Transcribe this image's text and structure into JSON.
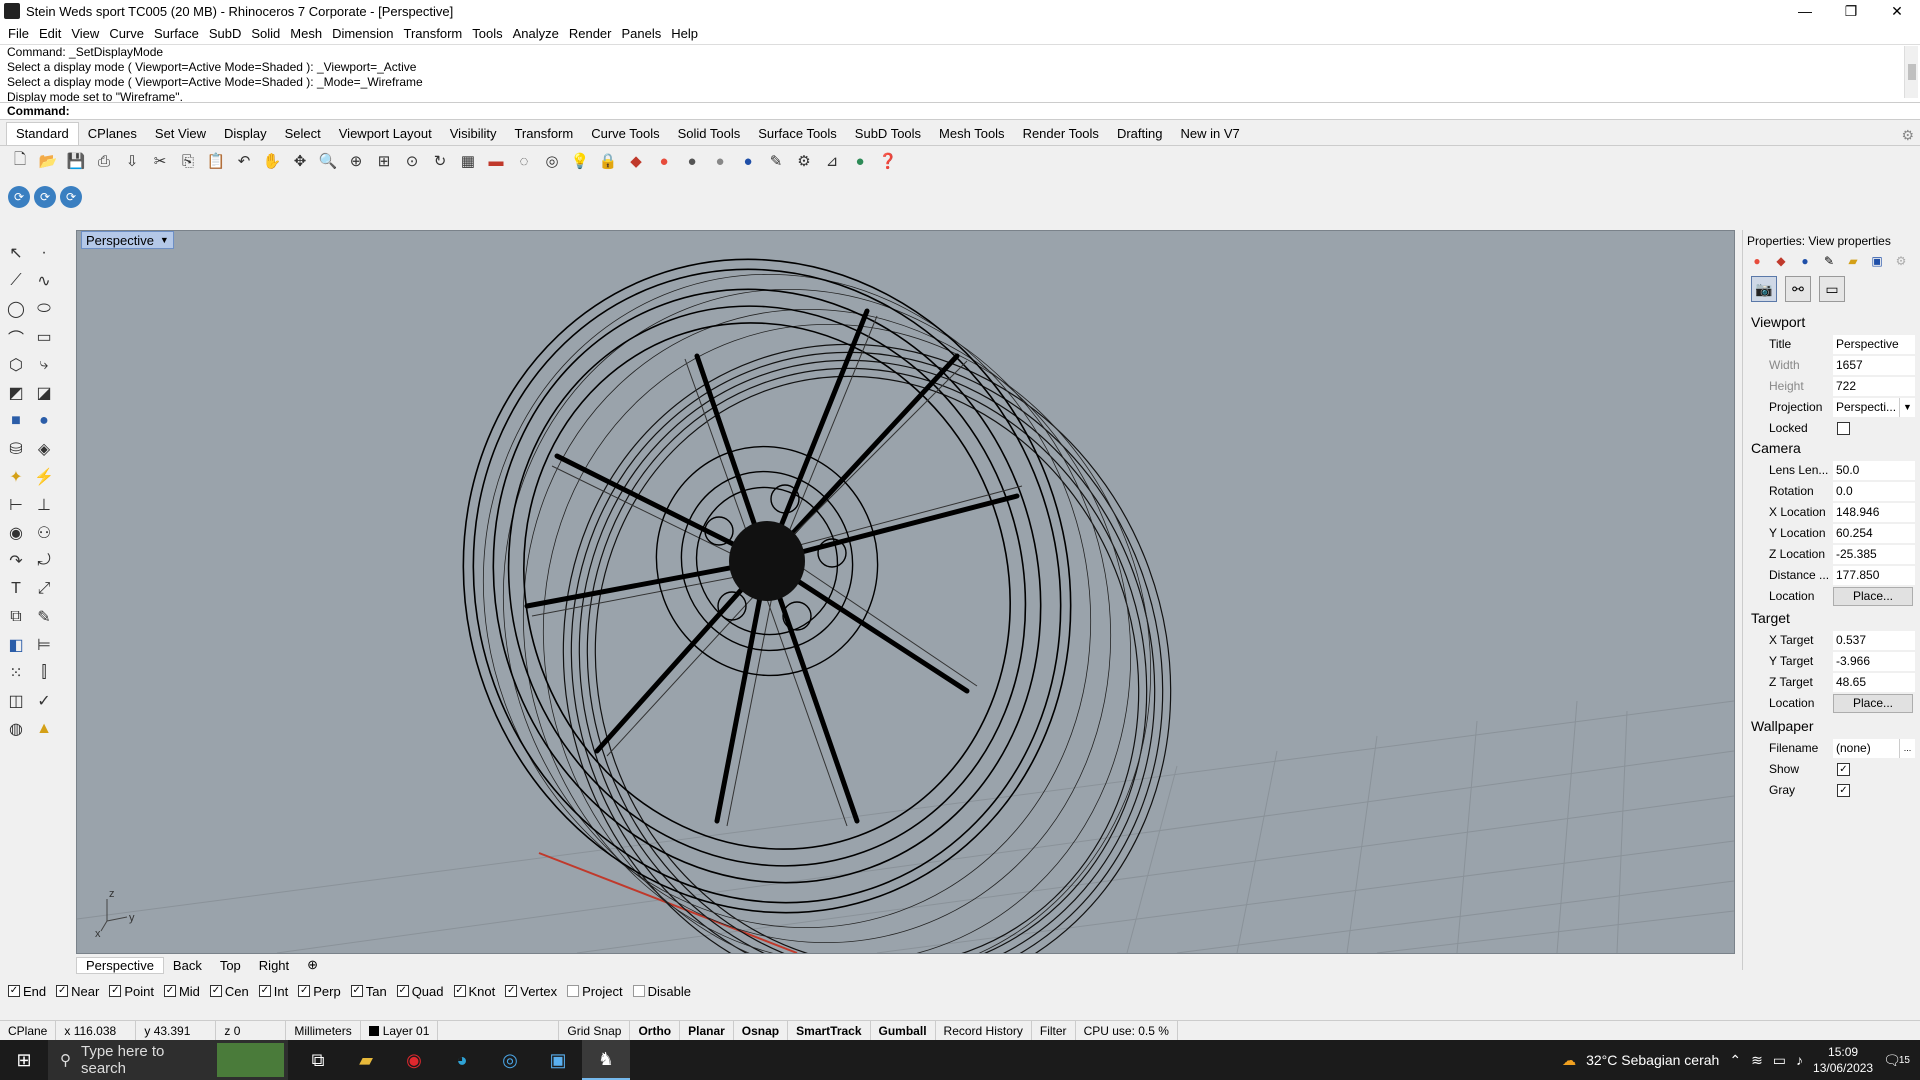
{
  "window": {
    "title": "Stein Weds sport TC005 (20 MB) - Rhinoceros 7 Corporate - [Perspective]",
    "icon": "rhino-app-icon",
    "controls": [
      "—",
      "❐",
      "✕"
    ]
  },
  "menu": [
    "File",
    "Edit",
    "View",
    "Curve",
    "Surface",
    "SubD",
    "Solid",
    "Mesh",
    "Dimension",
    "Transform",
    "Tools",
    "Analyze",
    "Render",
    "Panels",
    "Help"
  ],
  "command_history": [
    "Command: _SetDisplayMode",
    "Select a display mode ( Viewport=Active  Mode=Shaded ): _Viewport=_Active",
    "Select a display mode ( Viewport=Active  Mode=Shaded ): _Mode=_Wireframe",
    "Display mode set to \"Wireframe\"."
  ],
  "command_prompt": {
    "label": "Command:",
    "value": ""
  },
  "toolbar_tabs": [
    "Standard",
    "CPlanes",
    "Set View",
    "Display",
    "Select",
    "Viewport Layout",
    "Visibility",
    "Transform",
    "Curve Tools",
    "Solid Tools",
    "Surface Tools",
    "SubD Tools",
    "Mesh Tools",
    "Render Tools",
    "Drafting",
    "New in V7"
  ],
  "active_tab": "Standard",
  "standard_icons": [
    "new-icon",
    "open-icon",
    "save-icon",
    "print-icon",
    "import-icon",
    "cut-icon",
    "copy-icon",
    "paste-icon",
    "undo-icon",
    "pan-icon",
    "move-view-icon",
    "zoom-icon",
    "zoom-window-icon",
    "zoom-extents-icon",
    "zoom-selected-icon",
    "rotate-view-icon",
    "grid-icon",
    "car-icon",
    "object-snap-icon",
    "sphere-icon",
    "light-icon",
    "lock-icon",
    "layer-icon",
    "color-wheel-icon",
    "material-icon",
    "render-sphere-icon",
    "blue-sphere-icon",
    "tools-icon",
    "gear-icon",
    "dimension-icon",
    "world-icon",
    "help-icon"
  ],
  "viewport": {
    "name": "Perspective",
    "axis_x": "x",
    "axis_y": "y",
    "axis_z": "z"
  },
  "viewport_tabs": [
    "Perspective",
    "Back",
    "Top",
    "Right"
  ],
  "osnaps": [
    {
      "label": "End",
      "checked": true
    },
    {
      "label": "Near",
      "checked": true
    },
    {
      "label": "Point",
      "checked": true
    },
    {
      "label": "Mid",
      "checked": true
    },
    {
      "label": "Cen",
      "checked": true
    },
    {
      "label": "Int",
      "checked": true
    },
    {
      "label": "Perp",
      "checked": true
    },
    {
      "label": "Tan",
      "checked": true
    },
    {
      "label": "Quad",
      "checked": true
    },
    {
      "label": "Knot",
      "checked": true
    },
    {
      "label": "Vertex",
      "checked": true
    },
    {
      "label": "Project",
      "checked": false
    },
    {
      "label": "Disable",
      "checked": false
    }
  ],
  "status": {
    "cplane": "CPlane",
    "x": "x 116.038",
    "y": "y 43.391",
    "z": "z 0",
    "units": "Millimeters",
    "layer": "Layer 01",
    "grid_snap": "Grid Snap",
    "ortho": "Ortho",
    "planar": "Planar",
    "osnap": "Osnap",
    "smarttrack": "SmartTrack",
    "gumball": "Gumball",
    "record_history": "Record History",
    "filter": "Filter",
    "cpu": "CPU use: 0.5 %"
  },
  "properties": {
    "title": "Properties: View properties",
    "viewport_section": "Viewport",
    "vp_title_label": "Title",
    "vp_title": "Perspective",
    "width_label": "Width",
    "width": "1657",
    "height_label": "Height",
    "height": "722",
    "projection_label": "Projection",
    "projection": "Perspecti...",
    "locked_label": "Locked",
    "locked": false,
    "camera_section": "Camera",
    "lens_label": "Lens Len...",
    "lens": "50.0",
    "rotation_label": "Rotation",
    "rotation": "0.0",
    "xloc_label": "X Location",
    "xloc": "148.946",
    "yloc_label": "Y Location",
    "yloc": "60.254",
    "zloc_label": "Z Location",
    "zloc": "-25.385",
    "distance_label": "Distance ...",
    "distance": "177.850",
    "cam_location_label": "Location",
    "cam_place": "Place...",
    "target_section": "Target",
    "xt_label": "X Target",
    "xt": "0.537",
    "yt_label": "Y Target",
    "yt": "-3.966",
    "zt_label": "Z Target",
    "zt": "48.65",
    "tgt_location_label": "Location",
    "tgt_place": "Place...",
    "wallpaper_section": "Wallpaper",
    "filename_label": "Filename",
    "filename": "(none)",
    "browse": "...",
    "show_label": "Show",
    "show": true,
    "gray_label": "Gray",
    "gray": true
  },
  "taskbar": {
    "search_placeholder": "Type here to search",
    "weather": "32°C  Sebagian cerah",
    "time": "15:09",
    "date": "13/06/2023",
    "notifications": "15"
  },
  "colors": {
    "viewport_bg": "#9aa3ab",
    "viewport_label_bg": "#b4c8e8",
    "taskbar_bg": "#1b1b1b"
  }
}
